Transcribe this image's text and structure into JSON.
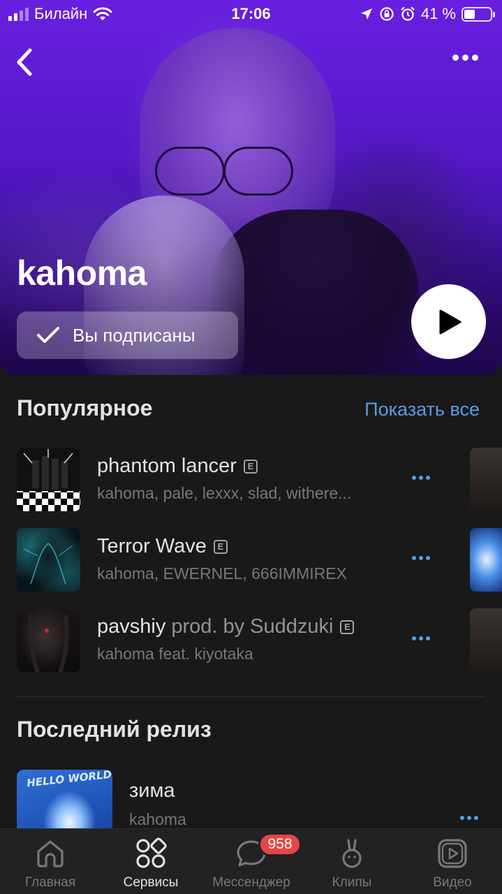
{
  "status_bar": {
    "carrier": "Билайн",
    "time": "17:06",
    "battery": "41 %",
    "battery_level": 0.41,
    "icons": [
      "signal-icon",
      "wifi-icon",
      "location-icon",
      "lock-rotation-icon",
      "alarm-icon",
      "battery-icon"
    ]
  },
  "header": {
    "back_icon": "chevron-left-icon",
    "more_icon": "more-horizontal-icon"
  },
  "artist": {
    "name": "kahoma",
    "follow_label": "Вы подписаны",
    "follow_icon": "check-icon",
    "play_icon": "play-icon"
  },
  "popular": {
    "title": "Популярное",
    "show_all": "Показать все",
    "tracks": [
      {
        "title": "phantom lancer",
        "subtitle": "",
        "explicit": "E",
        "artists": "kahoma, pale, lexxx, slad, withere..."
      },
      {
        "title": "Terror Wave",
        "subtitle": "",
        "explicit": "E",
        "artists": "kahoma, EWERNEL, 666IMMIREX"
      },
      {
        "title": "pavshiy",
        "subtitle": "prod. by Suddzuki",
        "explicit": "E",
        "artists": "kahoma feat. kiyotaka"
      }
    ]
  },
  "latest_release": {
    "title": "Последний релиз",
    "album_title": "зима",
    "album_artist": "kahoma",
    "cover_text": "HELLO WORLD"
  },
  "tabbar": {
    "tabs": [
      {
        "label": "Главная",
        "icon": "home-icon"
      },
      {
        "label": "Сервисы",
        "icon": "services-icon",
        "active": true
      },
      {
        "label": "Мессенджер",
        "icon": "messenger-icon"
      },
      {
        "label": "Клипы",
        "icon": "clips-icon"
      },
      {
        "label": "Видео",
        "icon": "video-icon"
      }
    ],
    "messenger_badge": "958"
  },
  "colors": {
    "accent": "#5a9be6",
    "badge": "#e64646",
    "background": "#191919",
    "hero": "#5518c8"
  }
}
